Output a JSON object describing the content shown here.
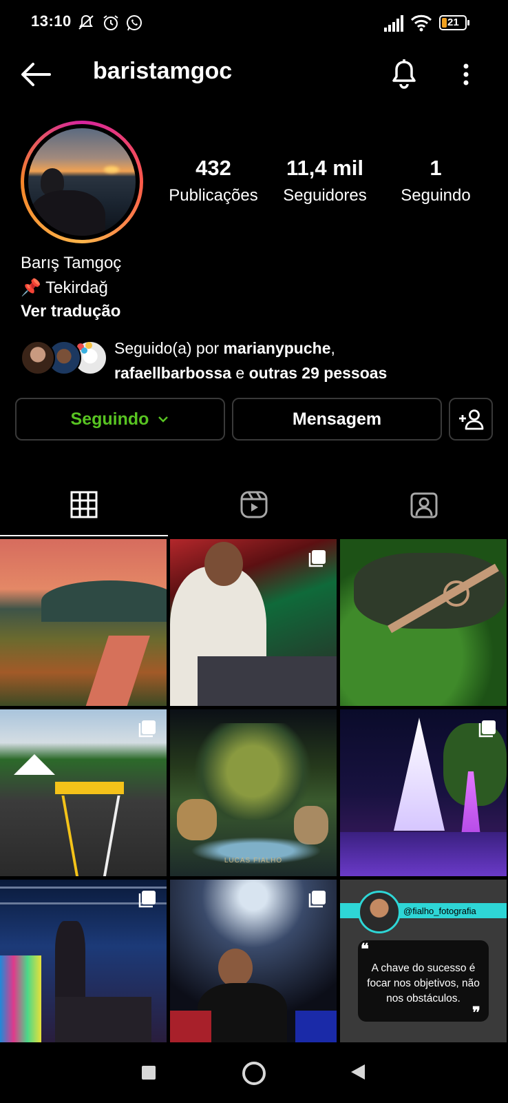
{
  "status_bar": {
    "time": "13:10",
    "battery": "21"
  },
  "header": {
    "username": "baristamgoc"
  },
  "profile": {
    "stats": [
      {
        "value": "432",
        "label": "Publicações"
      },
      {
        "value": "11,4 mil",
        "label": "Seguidores"
      },
      {
        "value": "1",
        "label": "Seguindo"
      }
    ],
    "full_name": "Barış Tamgoç",
    "location_emoji": "📌",
    "location": "Tekirdağ",
    "translate_link": "Ver tradução",
    "followed_by": {
      "prefix": "Seguido(a) por ",
      "user1": "marianypuche",
      "separator": ",",
      "user2": "rafaellbarbossa",
      "conjunction": " e ",
      "others": "outras 29 pessoas"
    }
  },
  "buttons": {
    "following": "Seguindo",
    "message": "Mensagem"
  },
  "grid": {
    "quote_handle": "@fialho_fotografia",
    "quote_text": "A chave do sucesso é focar nos objetivos, não nos obstáculos.",
    "watermark": "LUCAS FIALHO"
  },
  "colors": {
    "accent_following": "#58c322",
    "background": "#000000",
    "quote_banner": "#2ed6d6"
  }
}
